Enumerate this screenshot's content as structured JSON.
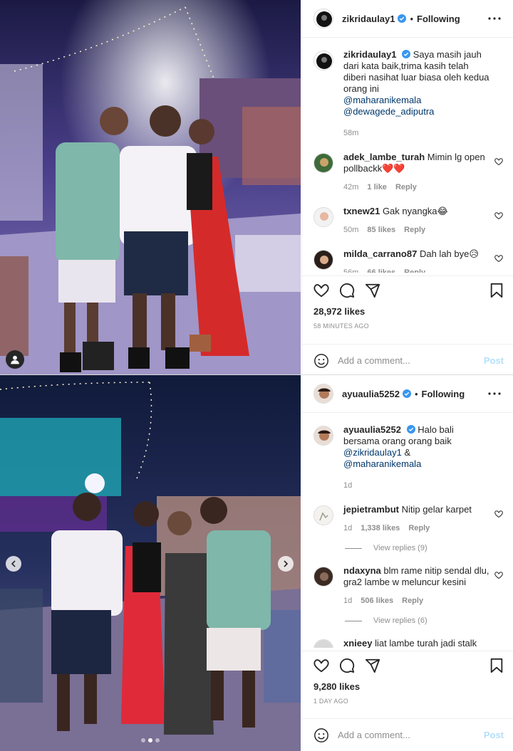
{
  "post1": {
    "header": {
      "username": "zikridaulay1",
      "follow_label": "Following"
    },
    "caption": {
      "username": "zikridaulay1",
      "text": "Saya masih jauh dari kata baik,trima kasih telah diberi nasihat luar biasa oleh kedua orang ini",
      "mention1": "@maharanikemala",
      "mention2": "@dewagede_adiputra",
      "time": "58m"
    },
    "comments": [
      {
        "username": "adek_lambe_turah",
        "text": "Mimin lg open pollbackk",
        "emoji": "❤️❤️",
        "time": "42m",
        "likes": "1 like",
        "reply": "Reply"
      },
      {
        "username": "txnew21",
        "text": "Gak nyangka",
        "emoji": "😂",
        "time": "50m",
        "likes": "85 likes",
        "reply": "Reply"
      },
      {
        "username": "milda_carrano87",
        "text": "Dah lah bye",
        "emoji": "😥",
        "time": "56m",
        "likes": "66 likes",
        "reply": "Reply"
      }
    ],
    "likes": "28,972 likes",
    "ago": "58 MINUTES AGO",
    "add_comment_placeholder": "Add a comment...",
    "post_label": "Post"
  },
  "post2": {
    "header": {
      "username": "ayuaulia5252",
      "follow_label": "Following"
    },
    "caption": {
      "username": "ayuaulia5252",
      "text": "Halo bali bersama orang orang baik",
      "mention1": "@zikridaulay1",
      "amp": "&",
      "mention2": "@maharanikemala",
      "time": "1d"
    },
    "comments": [
      {
        "username": "jepietrambut",
        "text": "Nitip gelar karpet",
        "time": "1d",
        "likes": "1,338 likes",
        "reply": "Reply",
        "view_replies": "View replies (9)"
      },
      {
        "username": "ndaxyna",
        "text": "blm rame nitip sendal dlu, gra2 lambe w meluncur kesini",
        "time": "1d",
        "likes": "506 likes",
        "reply": "Reply",
        "view_replies": "View replies (6)"
      },
      {
        "username": "xnieey",
        "text": "liat lambe turah jadi stalk"
      }
    ],
    "likes": "9,280 likes",
    "ago": "1 DAY AGO",
    "add_comment_placeholder": "Add a comment...",
    "post_label": "Post"
  },
  "colors": {
    "verified": "#3897f0",
    "link": "#00376b",
    "muted": "#8e8e8e",
    "post_disabled": "#b2dffc"
  }
}
